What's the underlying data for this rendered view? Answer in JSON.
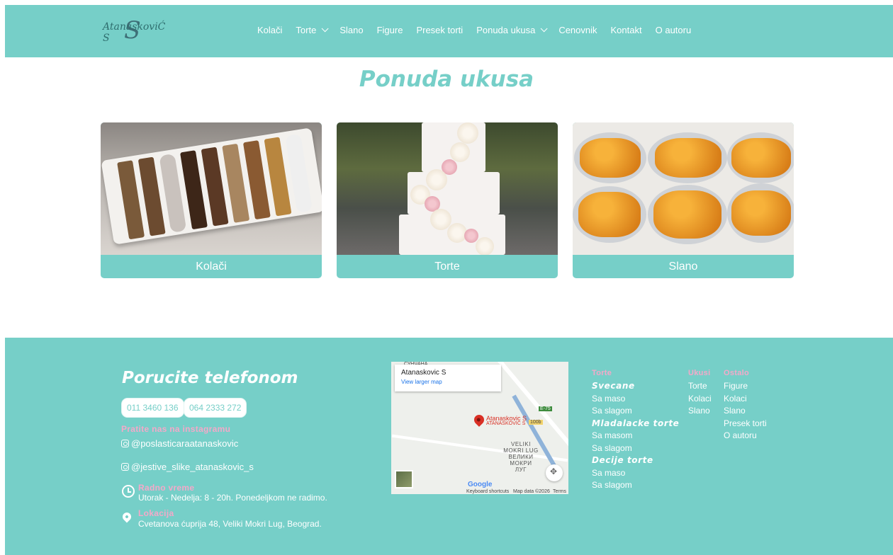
{
  "brand": {
    "logo_text": "AtanaskoviĆ S",
    "logo_letter": "S"
  },
  "nav": {
    "items": [
      {
        "label": "Kolači",
        "dropdown": false
      },
      {
        "label": "Torte",
        "dropdown": true
      },
      {
        "label": "Slano",
        "dropdown": false
      },
      {
        "label": "Figure",
        "dropdown": false
      },
      {
        "label": "Presek torti",
        "dropdown": false
      },
      {
        "label": "Ponuda ukusa",
        "dropdown": true
      },
      {
        "label": "Cenovnik",
        "dropdown": false
      },
      {
        "label": "Kontakt",
        "dropdown": false
      },
      {
        "label": "O autoru",
        "dropdown": false
      }
    ]
  },
  "page": {
    "title": "Ponuda ukusa"
  },
  "cards": [
    {
      "label": "Kolači"
    },
    {
      "label": "Torte"
    },
    {
      "label": "Slano"
    }
  ],
  "footer": {
    "title": "Porucite telefonom",
    "phones": [
      "011 3460 136",
      "064 2333 272"
    ],
    "instagram_heading": "Pratite nas na instagramu",
    "instagram": [
      "@poslasticaraatanaskovic",
      "@jestive_slike_atanaskovic_s"
    ],
    "hours_heading": "Radno vreme",
    "hours": "Utorak - Nedelja: 8 - 20h. Ponedeljkom ne radimo.",
    "location_heading": "Lokacija",
    "location": "Cvetanova ćuprija 48, Veliki Mokri Lug, Beograd.",
    "map": {
      "place_name": "Atanaskovic S",
      "view_larger": "View larger map",
      "pin_label_1": "Atanaskovic S",
      "pin_label_2": "ATANASKOVIĆ S",
      "town_line_1": "VELIKI",
      "town_line_2": "MOKRI LUG",
      "town_line_3": "ВЕЛИКИ",
      "town_line_4": "МОКРИ ЛУГ",
      "top_label": "СУНЧАНА",
      "road_label": "Е-75",
      "road_label_2": "100b",
      "google": "Google",
      "keyboard": "Keyboard shortcuts",
      "mapdata": "Map data ©2026",
      "terms": "Terms"
    },
    "columns": {
      "torte": {
        "heading": "Torte",
        "groups": [
          {
            "title": "Svecane",
            "items": [
              "Sa maso",
              "Sa slagom"
            ]
          },
          {
            "title": "Mladalacke torte",
            "items": [
              "Sa masom",
              "Sa slagom"
            ]
          },
          {
            "title": "Decije torte",
            "items": [
              "Sa maso",
              "Sa slagom"
            ]
          }
        ]
      },
      "ukusi": {
        "heading": "Ukusi",
        "items": [
          "Torte",
          "Kolaci",
          "Slano"
        ]
      },
      "ostalo": {
        "heading": "Ostalo",
        "items": [
          "Figure",
          "Kolaci",
          "Slano",
          "Presek torti",
          "O autoru"
        ]
      }
    }
  },
  "colors": {
    "teal": "#76cfc8",
    "pink": "#f4a9c9",
    "white": "#ffffff"
  }
}
